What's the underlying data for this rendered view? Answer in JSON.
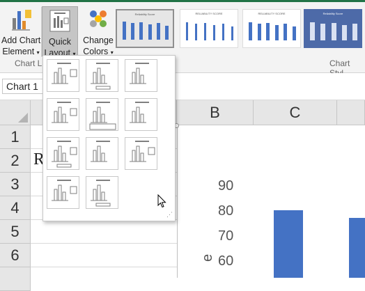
{
  "ribbon": {
    "add_chart_label_1": "Add Chart",
    "add_chart_label_2": "Element",
    "quick_layout_label_1": "Quick",
    "quick_layout_label_2": "Layout",
    "change_colors_label_1": "Change",
    "change_colors_label_2": "Colors",
    "caret": "▾",
    "group_chart_layouts": "Chart La",
    "group_chart_styles": "Chart Styl",
    "styles": [
      {
        "title": "Reliability Score"
      },
      {
        "title": "RELIABILITY SCORE"
      },
      {
        "title": "RELIABILITY SCORE"
      },
      {
        "title": "Reliability Score"
      }
    ]
  },
  "formula_bar": {
    "name_box": "Chart 1"
  },
  "sheet": {
    "columns": [
      "B",
      "C"
    ],
    "rows": [
      "1",
      "2",
      "3",
      "4",
      "5",
      "6"
    ],
    "cell_a2_partial": "R"
  },
  "chart_data": {
    "type": "bar",
    "yticks": [
      "90",
      "80",
      "70",
      "60"
    ],
    "values": [
      80,
      77
    ],
    "ylabel_partial": "e",
    "ylim": [
      55,
      95
    ]
  },
  "colors": {
    "accent": "#217346",
    "bar": "#4472c4"
  }
}
